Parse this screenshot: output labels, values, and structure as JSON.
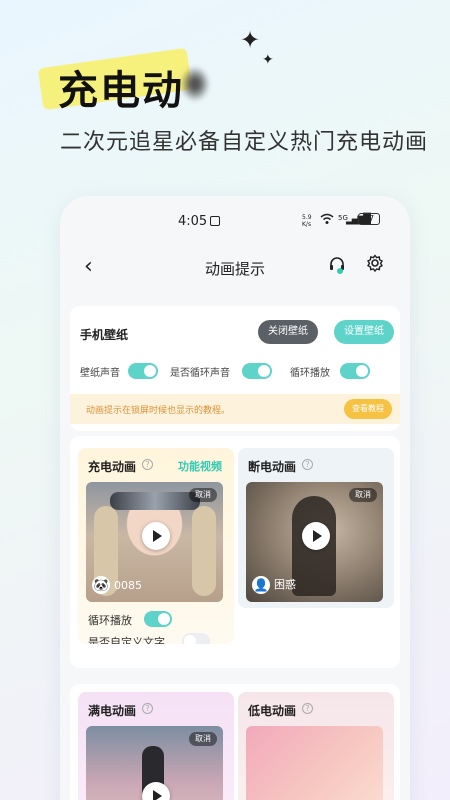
{
  "hero": {
    "title": "充电动",
    "subtitle": "二次元追星必备自定义热门充电动画",
    "sparkle": "✦"
  },
  "statusbar": {
    "time": "4:05",
    "net_speed_top": "5.9",
    "net_speed_bottom": "K/s",
    "network": "5G",
    "battery": "77"
  },
  "navbar": {
    "back_icon": "‹",
    "title": "动画提示",
    "service_icon": "headset-icon",
    "settings_icon": "gear-icon"
  },
  "wallpaper": {
    "title": "手机壁纸",
    "close_label": "关闭壁纸",
    "set_label": "设置壁纸",
    "toggles": [
      {
        "label": "壁纸声音",
        "on": true
      },
      {
        "label": "是否循环声音",
        "on": true
      },
      {
        "label": "循环播放",
        "on": true
      }
    ],
    "tip_text": "动画提示在锁屏时候也显示的教程。",
    "tutorial_label": "查看教程"
  },
  "cards": {
    "charge": {
      "title": "充电动画",
      "function_link": "功能视频",
      "cancel": "取消",
      "caption": "0085",
      "loop_label": "循环播放",
      "loop_on": true,
      "custom_label": "是否自定义文字",
      "custom_on": false
    },
    "disconnect": {
      "title": "断电动画",
      "cancel": "取消",
      "caption": "困惑"
    },
    "full": {
      "title": "满电动画",
      "cancel": "取消"
    },
    "low": {
      "title": "低电动画"
    }
  },
  "colors": {
    "accent": "#5ed3c9",
    "tip_text": "#e0903a",
    "tip_button": "#f6c244"
  }
}
